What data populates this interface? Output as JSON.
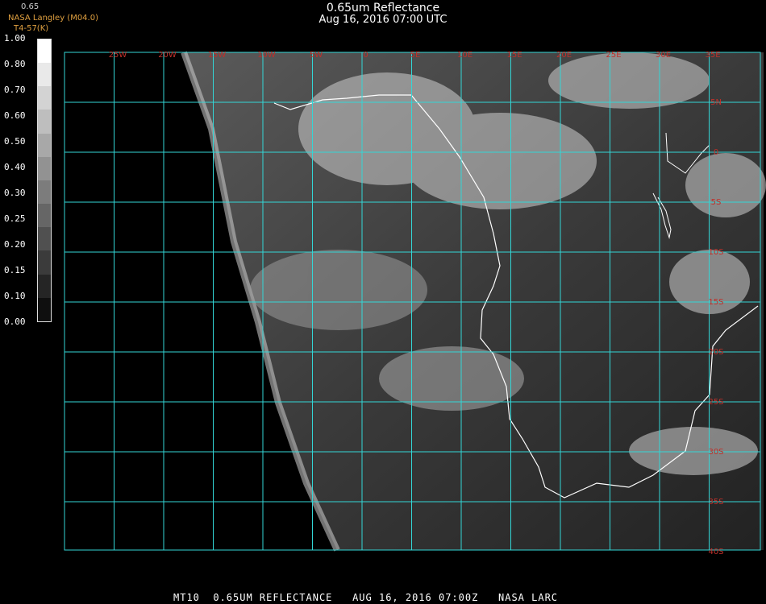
{
  "header": {
    "title": "0.65um Reflectance",
    "date": "Aug 16, 2016 07:00 UTC"
  },
  "credits": {
    "top": "0.65",
    "producer": "NASA Langley (M04.0)",
    "sub": "T4-57(K)"
  },
  "colorbar": {
    "labels": [
      "1.00",
      "0.80",
      "0.70",
      "0.60",
      "0.50",
      "0.40",
      "0.30",
      "0.25",
      "0.20",
      "0.15",
      "0.10",
      "0.00"
    ]
  },
  "map": {
    "lon_labels": [
      "25W",
      "20W",
      "15W",
      "10W",
      "5W",
      "0",
      "5E",
      "10E",
      "15E",
      "20E",
      "25E",
      "30E",
      "35E"
    ],
    "lat_labels": [
      "5N",
      "0",
      "5S",
      "10S",
      "15S",
      "20S",
      "25S",
      "30S",
      "35S",
      "40S"
    ],
    "grid_color": "#33d6d6",
    "label_color": "#c0302a",
    "coast_color": "#ffffff"
  },
  "footer": {
    "text": "MT10  0.65UM REFLECTANCE   AUG 16, 2016 07:00Z   NASA LARC"
  }
}
